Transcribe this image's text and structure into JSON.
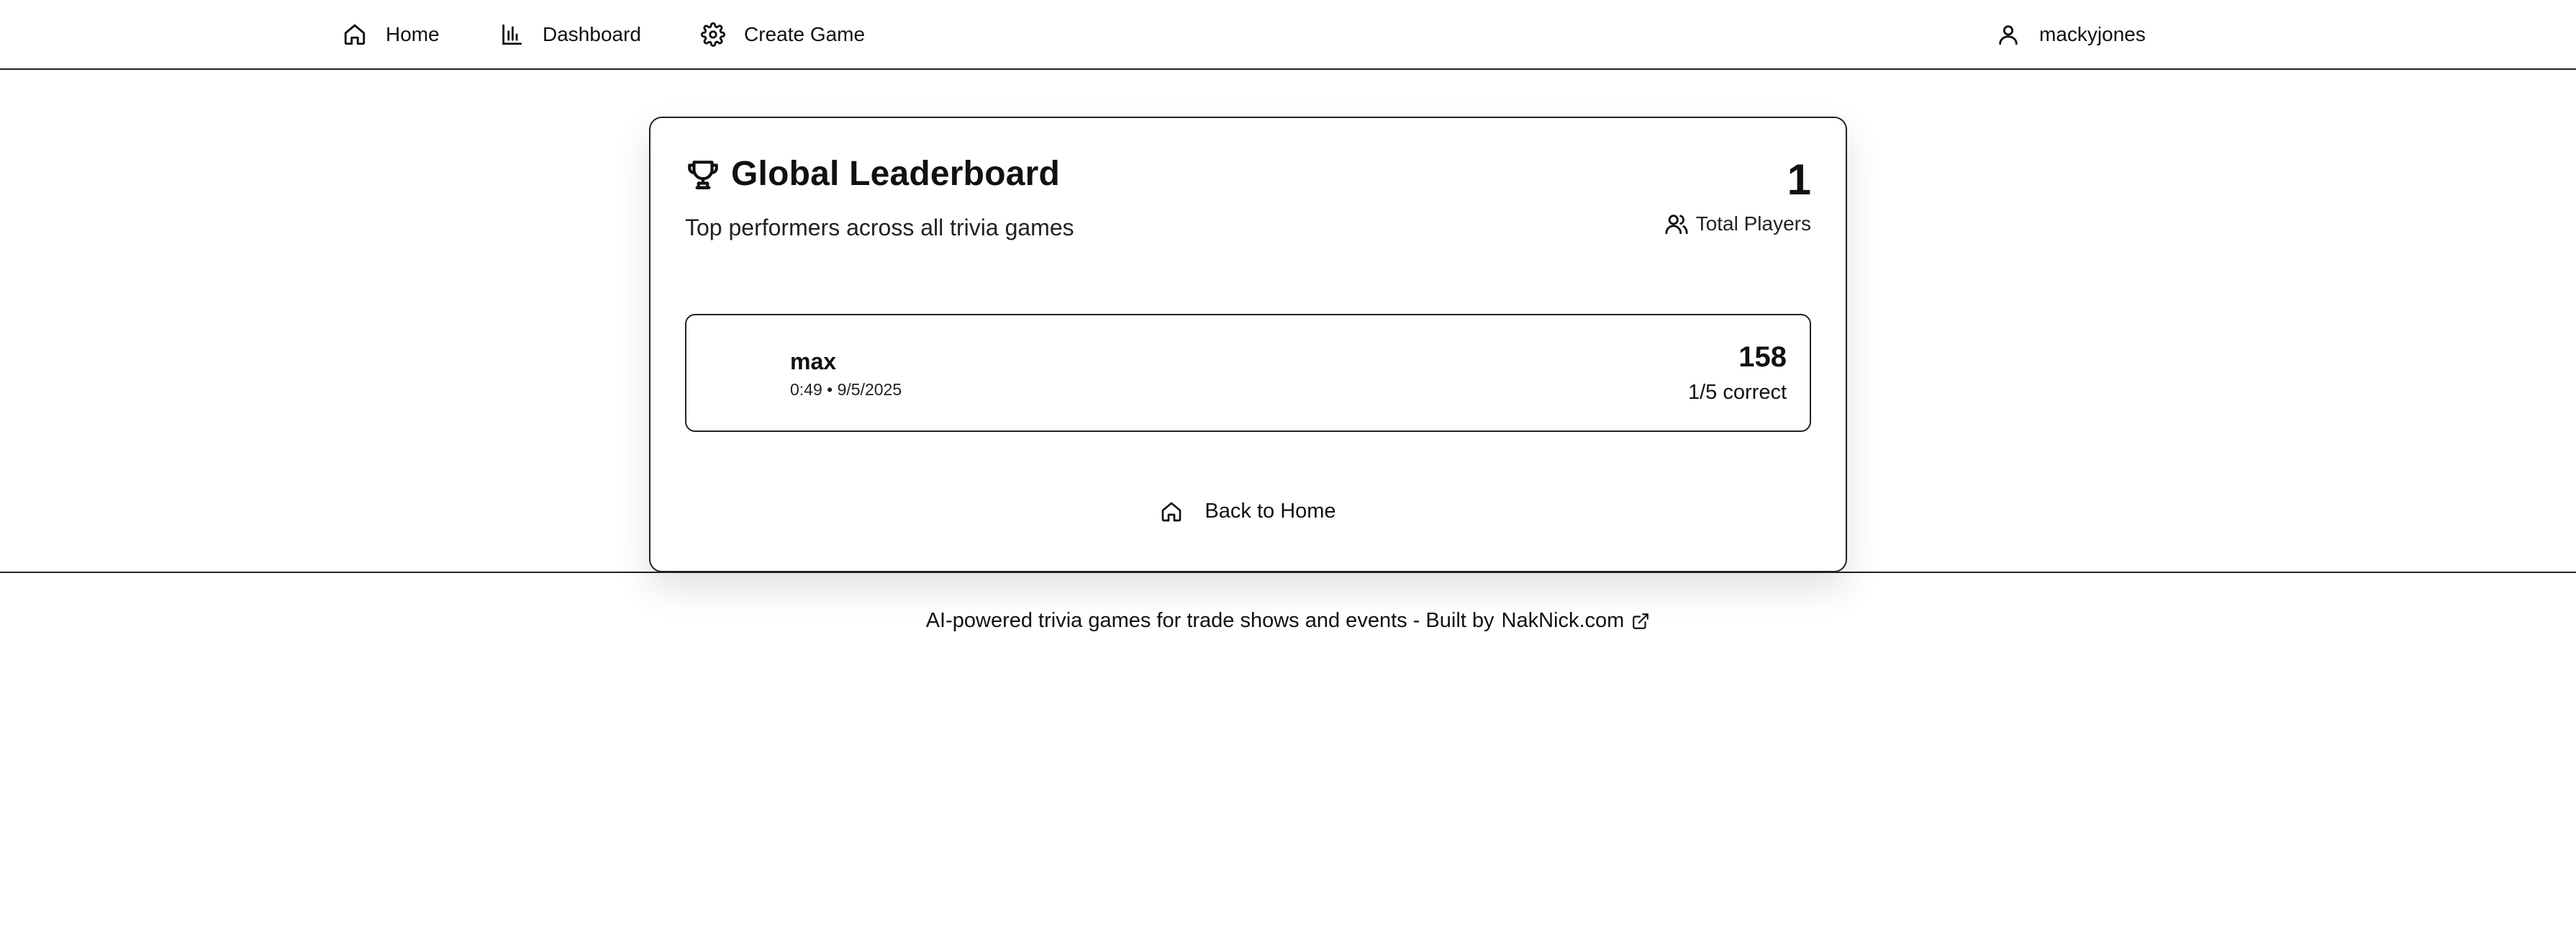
{
  "nav": {
    "home_label": "Home",
    "dashboard_label": "Dashboard",
    "create_label": "Create Game",
    "username": "mackyjones",
    "icons": [
      "home-icon",
      "bar-chart-icon",
      "gear-icon",
      "user-icon"
    ]
  },
  "leaderboard": {
    "title": "Global Leaderboard",
    "subtitle": "Top performers across all trivia games",
    "total_players_value": "1",
    "total_players_label": "Total Players",
    "entries": [
      {
        "name": "max",
        "meta": "0:49 • 9/5/2025",
        "score": "158",
        "correct": "1/5 correct"
      }
    ],
    "back_label": "Back to Home"
  },
  "footer": {
    "text": "AI-powered trivia games for trade shows and events - Built by",
    "link_label": "NakNick.com"
  }
}
